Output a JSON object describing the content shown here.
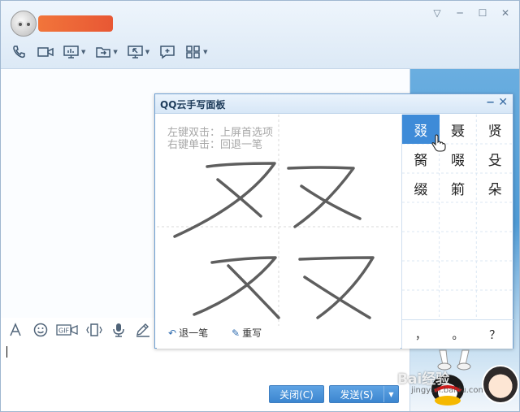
{
  "window": {
    "contact_name": "",
    "controls": {
      "menu": "▽",
      "minimize": "─",
      "maximize": "☐",
      "close": "✕"
    }
  },
  "toolbar": {
    "items": [
      {
        "icon": "phone-icon"
      },
      {
        "icon": "video-icon"
      },
      {
        "icon": "screen-share-icon",
        "dropdown": true
      },
      {
        "icon": "file-transfer-icon",
        "dropdown": true
      },
      {
        "icon": "remote-assist-icon",
        "dropdown": true
      },
      {
        "icon": "chat-bubble-plus-icon"
      },
      {
        "icon": "apps-grid-icon",
        "dropdown": true
      }
    ]
  },
  "input_toolbar": {
    "items": [
      "font-icon",
      "emoji-icon",
      "gif-icon",
      "shake-icon",
      "microphone-icon",
      "pen-icon"
    ],
    "gif_label": "GIF"
  },
  "buttons": {
    "close_label": "关闭(C)",
    "send_label": "发送(S)"
  },
  "handwriting": {
    "title": "QQ云手写面板",
    "hint_line1": "左键双击：上屏首选项",
    "hint_line2": "右键单击：回退一笔",
    "undo_label": "退一笔",
    "rewrite_label": "重写",
    "candidates": [
      [
        "叕",
        "聂",
        "贤"
      ],
      [
        "胬",
        "啜",
        "殳"
      ],
      [
        "缀",
        "箣",
        "朵"
      ]
    ],
    "selected": "叕",
    "punctuation": [
      "，",
      "。",
      "？"
    ]
  },
  "watermark": {
    "brand": "Bai经验",
    "url": "jingyan.baidu.com"
  },
  "colors": {
    "accent": "#3e8bd8",
    "stroke": "#5e5e5e",
    "name_highlight": "#f0622a"
  }
}
